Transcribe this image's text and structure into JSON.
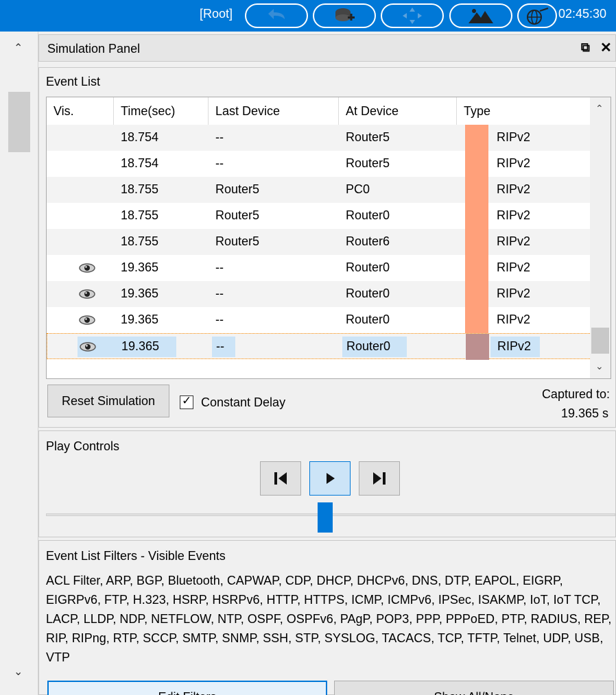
{
  "topbar": {
    "root_label": "[Root]",
    "clock": "02:45:30",
    "icons": [
      "undo-icon",
      "add-device-icon",
      "move-icon",
      "mountain-icon",
      "globe-icon"
    ]
  },
  "panel": {
    "title": "Simulation Panel",
    "undock_glyph": "⧉",
    "close_glyph": "✕"
  },
  "event_list": {
    "title": "Event List",
    "columns": [
      "Vis.",
      "Time(sec)",
      "Last Device",
      "At Device",
      "Type"
    ],
    "rows": [
      {
        "vis": false,
        "time": "18.754",
        "last": "--",
        "at": "Router5",
        "type": "RIPv2",
        "color": "#ffa07a"
      },
      {
        "vis": false,
        "time": "18.754",
        "last": "--",
        "at": "Router5",
        "type": "RIPv2",
        "color": "#ffa07a"
      },
      {
        "vis": false,
        "time": "18.755",
        "last": "Router5",
        "at": "PC0",
        "type": "RIPv2",
        "color": "#ffa07a"
      },
      {
        "vis": false,
        "time": "18.755",
        "last": "Router5",
        "at": "Router0",
        "type": "RIPv2",
        "color": "#ffa07a"
      },
      {
        "vis": false,
        "time": "18.755",
        "last": "Router5",
        "at": "Router6",
        "type": "RIPv2",
        "color": "#ffa07a"
      },
      {
        "vis": true,
        "time": "19.365",
        "last": "--",
        "at": "Router0",
        "type": "RIPv2",
        "color": "#ffa07a"
      },
      {
        "vis": true,
        "time": "19.365",
        "last": "--",
        "at": "Router0",
        "type": "RIPv2",
        "color": "#ffa07a"
      },
      {
        "vis": true,
        "time": "19.365",
        "last": "--",
        "at": "Router0",
        "type": "RIPv2",
        "color": "#ffa07a"
      },
      {
        "vis": true,
        "time": "19.365",
        "last": "--",
        "at": "Router0",
        "type": "RIPv2",
        "color": "#bc8f8f",
        "selected": true
      }
    ],
    "reset_label": "Reset Simulation",
    "constant_delay_label": "Constant Delay",
    "constant_delay_checked": true,
    "captured_label": "Captured to:",
    "captured_value": "19.365 s"
  },
  "play_controls": {
    "title": "Play Controls",
    "slider_fraction": 0.49
  },
  "filters": {
    "title": "Event List Filters - Visible Events",
    "list": "ACL Filter, ARP, BGP, Bluetooth, CAPWAP, CDP, DHCP, DHCPv6, DNS, DTP, EAPOL, EIGRP, EIGRPv6, FTP, H.323, HSRP, HSRPv6, HTTP, HTTPS, ICMP, ICMPv6, IPSec, ISAKMP, IoT, IoT TCP, LACP, LLDP, NDP, NETFLOW, NTP, OSPF, OSPFv6, PAgP, POP3, PPP, PPPoED, PTP, RADIUS, REP, RIP, RIPng, RTP, SCCP, SMTP, SNMP, SSH, STP, SYSLOG, TACACS, TCP, TFTP, Telnet, UDP, USB, VTP",
    "edit_label": "Edit Filters",
    "show_all_label": "Show All/None"
  }
}
